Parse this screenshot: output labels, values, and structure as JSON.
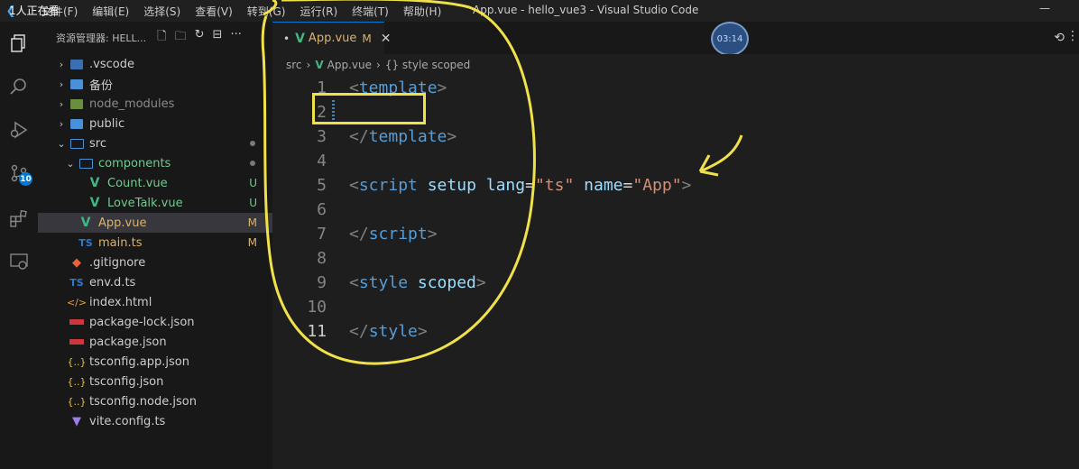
{
  "titlebar": {
    "watching": "1人正在看",
    "menu": [
      "文件(F)",
      "编辑(E)",
      "选择(S)",
      "查看(V)",
      "转到(G)",
      "运行(R)",
      "终端(T)",
      "帮助(H)"
    ],
    "window_title": "App.vue - hello_vue3 - Visual Studio Code",
    "minimize": "—"
  },
  "activity": {
    "scm_badge": "10"
  },
  "sidebar": {
    "title": "资源管理器: HELL...",
    "actions": [
      "new-file-icon",
      "new-folder-icon",
      "refresh-icon",
      "collapse-icon",
      "more-icon"
    ],
    "more_label": "···"
  },
  "tree": [
    {
      "name": ".vscode",
      "kind": "folder-special",
      "depth": 0,
      "chev": "›"
    },
    {
      "name": "备份",
      "kind": "folder",
      "depth": 0,
      "chev": "›"
    },
    {
      "name": "node_modules",
      "kind": "folder-node",
      "depth": 0,
      "chev": "›",
      "dim": true
    },
    {
      "name": "public",
      "kind": "folder",
      "depth": 0,
      "chev": "›"
    },
    {
      "name": "src",
      "kind": "folder-open",
      "depth": 0,
      "chev": "⌄",
      "dot": true
    },
    {
      "name": "components",
      "kind": "folder-open",
      "depth": 1,
      "chev": "⌄",
      "dot": true,
      "status_color": "untracked"
    },
    {
      "name": "Count.vue",
      "kind": "vue",
      "depth": 2,
      "status": "U",
      "status_color": "untracked"
    },
    {
      "name": "LoveTalk.vue",
      "kind": "vue",
      "depth": 2,
      "status": "U",
      "status_color": "untracked"
    },
    {
      "name": "App.vue",
      "kind": "vue",
      "depth": 1,
      "status": "M",
      "status_color": "modified",
      "selected": true
    },
    {
      "name": "main.ts",
      "kind": "ts",
      "depth": 1,
      "status": "M",
      "status_color": "modified"
    },
    {
      "name": ".gitignore",
      "kind": "git",
      "depth": 0
    },
    {
      "name": "env.d.ts",
      "kind": "ts",
      "depth": 0
    },
    {
      "name": "index.html",
      "kind": "html",
      "depth": 0
    },
    {
      "name": "package-lock.json",
      "kind": "npm",
      "depth": 0
    },
    {
      "name": "package.json",
      "kind": "npm",
      "depth": 0
    },
    {
      "name": "tsconfig.app.json",
      "kind": "json",
      "depth": 0
    },
    {
      "name": "tsconfig.json",
      "kind": "json",
      "depth": 0
    },
    {
      "name": "tsconfig.node.json",
      "kind": "json",
      "depth": 0
    },
    {
      "name": "vite.config.ts",
      "kind": "vite",
      "depth": 0
    }
  ],
  "tab": {
    "dot": "•",
    "name": "App.vue",
    "status": "M",
    "close": "✕"
  },
  "timer": "03:14",
  "breadcrumb": [
    "src",
    "App.vue",
    "{} style scoped"
  ],
  "code": [
    {
      "n": "1",
      "tokens": [
        [
          "<",
          "punc"
        ],
        [
          "template",
          "tag"
        ],
        [
          ">",
          "punc"
        ]
      ]
    },
    {
      "n": "2",
      "tokens": [],
      "mark": true
    },
    {
      "n": "3",
      "tokens": [
        [
          "</",
          "punc"
        ],
        [
          "template",
          "tag"
        ],
        [
          ">",
          "punc"
        ]
      ]
    },
    {
      "n": "4",
      "tokens": []
    },
    {
      "n": "5",
      "tokens": [
        [
          "<",
          "punc"
        ],
        [
          "script",
          "tag"
        ],
        [
          " ",
          "eq"
        ],
        [
          "setup",
          "attr"
        ],
        [
          " ",
          "eq"
        ],
        [
          "lang",
          "attr"
        ],
        [
          "=",
          "eq"
        ],
        [
          "\"ts\"",
          "str"
        ],
        [
          " ",
          "eq"
        ],
        [
          "name",
          "attr"
        ],
        [
          "=",
          "eq"
        ],
        [
          "\"App\"",
          "str"
        ],
        [
          ">",
          "punc"
        ]
      ]
    },
    {
      "n": "6",
      "tokens": []
    },
    {
      "n": "7",
      "tokens": [
        [
          "</",
          "punc"
        ],
        [
          "script",
          "tag"
        ],
        [
          ">",
          "punc"
        ]
      ]
    },
    {
      "n": "8",
      "tokens": []
    },
    {
      "n": "9",
      "tokens": [
        [
          "<",
          "punc"
        ],
        [
          "style",
          "tag"
        ],
        [
          " ",
          "eq"
        ],
        [
          "scoped",
          "attr"
        ],
        [
          ">",
          "punc"
        ]
      ]
    },
    {
      "n": "10",
      "tokens": []
    },
    {
      "n": "11",
      "tokens": [
        [
          "</",
          "punc"
        ],
        [
          "style",
          "tag"
        ],
        [
          ">",
          "punc"
        ]
      ],
      "active": true
    }
  ],
  "colors": {
    "accent": "#0078d4",
    "annotation": "#f0e14a",
    "vue": "#41b883",
    "modified": "#d9b36c",
    "untracked": "#73c991"
  }
}
